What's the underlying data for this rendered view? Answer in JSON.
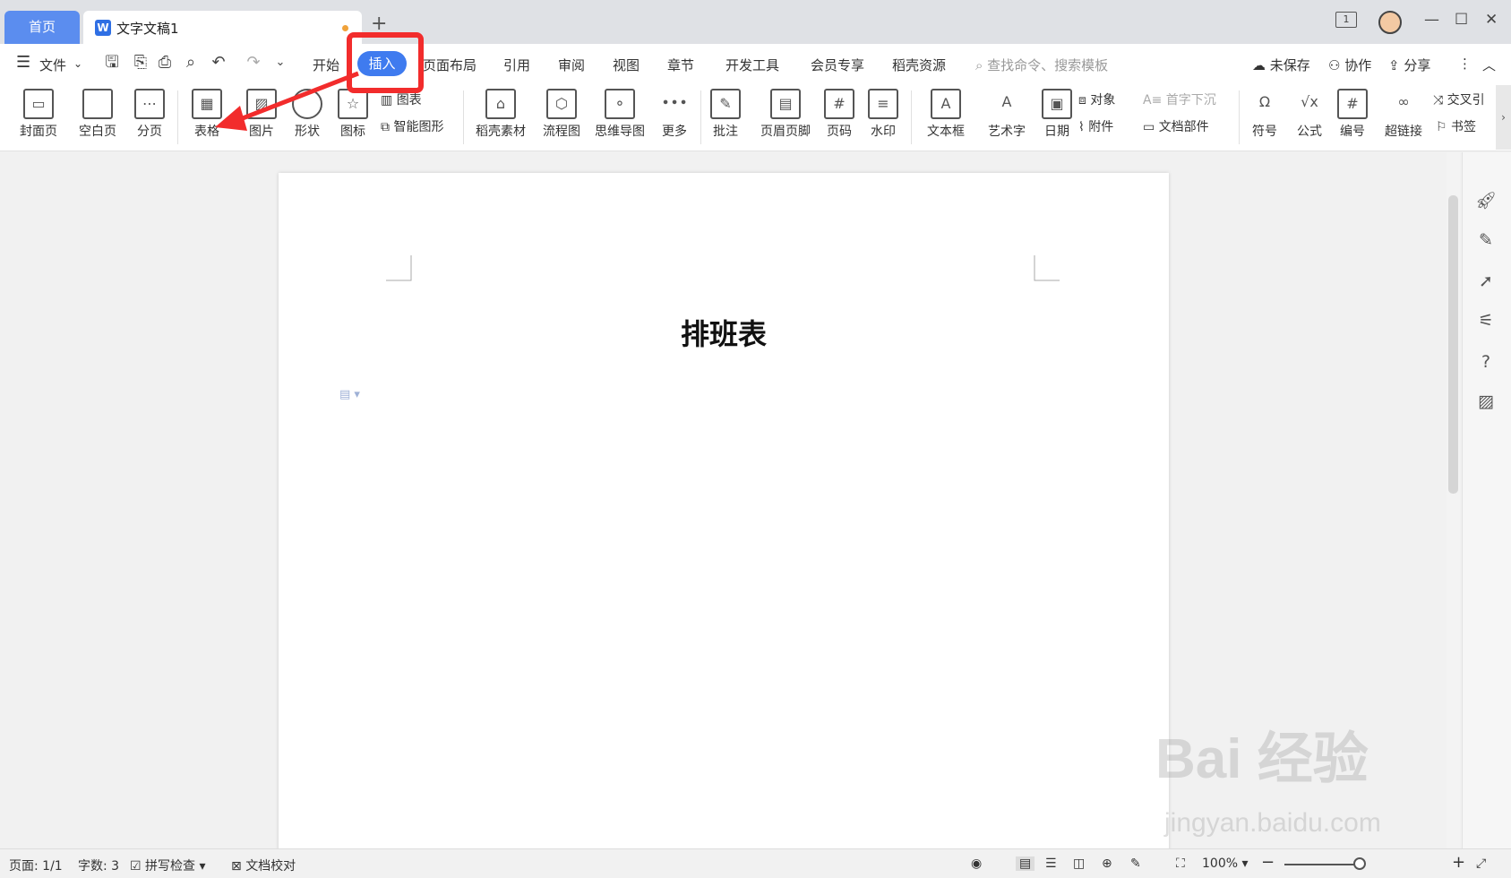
{
  "tabs": {
    "home": "首页",
    "doc": "文字文稿1",
    "new": "+"
  },
  "window": {
    "page_count_icon": "1"
  },
  "menu": {
    "file": "文件",
    "items": [
      "开始",
      "插入",
      "页面布局",
      "引用",
      "审阅",
      "视图",
      "章节",
      "开发工具",
      "会员专享",
      "稻壳资源"
    ],
    "active": "插入",
    "search_placeholder": "查找命令、搜索模板",
    "unsaved": "未保存",
    "collab": "协作",
    "share": "分享"
  },
  "ribbon": {
    "cover": "封面页",
    "blank": "空白页",
    "pagebreak": "分页",
    "table": "表格",
    "picture": "图片",
    "shape": "形状",
    "icon": "图标",
    "chart": "图表",
    "smartart": "智能图形",
    "docer": "稻壳素材",
    "flow": "流程图",
    "mindmap": "思维导图",
    "more": "更多",
    "comment": "批注",
    "header": "页眉页脚",
    "pagenum": "页码",
    "watermark": "水印",
    "textbox": "文本框",
    "wordart": "艺术字",
    "date": "日期",
    "object": "对象",
    "dropcap": "首字下沉",
    "attach": "附件",
    "docparts": "文档部件",
    "symbol": "符号",
    "formula": "公式",
    "numbering": "编号",
    "hyperlink": "超链接",
    "crossref": "交叉引",
    "bookmark": "书签"
  },
  "document": {
    "title": "排班表"
  },
  "status": {
    "page": "页面: 1/1",
    "words": "字数: 3",
    "spell": "拼写检查",
    "proof": "文档校对",
    "zoom": "100%"
  },
  "watermark": {
    "main": "Bai 经验",
    "sub": "jingyan.baidu.com"
  },
  "colors": {
    "accent": "#3f7bef",
    "highlight": "#f22c2c"
  }
}
